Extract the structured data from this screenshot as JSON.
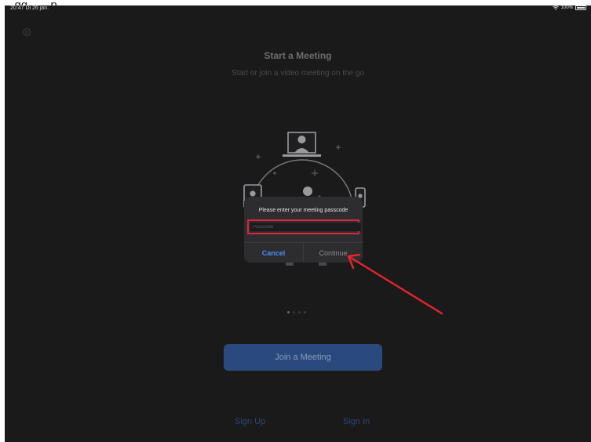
{
  "caption": "...gg...            ...p...",
  "status_bar": {
    "time": "20:47  Di 26 jan.",
    "battery": "100%"
  },
  "main": {
    "title": "Start a Meeting",
    "subtitle": "Start or join a video meeting on the go",
    "page_indicator": {
      "count": 4,
      "active": 0
    }
  },
  "dialog": {
    "title": "Please enter your meeting passcode",
    "passcode_placeholder": "Passcode",
    "passcode_value": "",
    "cancel_label": "Cancel",
    "continue_label": "Continue"
  },
  "join_button_label": "Join a Meeting",
  "footer": {
    "sign_up_label": "Sign Up",
    "sign_in_label": "Sign In"
  },
  "colors": {
    "background": "#1a1a1b",
    "accent_blue": "#4a8cf0",
    "highlight_red": "#d8263a",
    "join_button": "#2a4a7e"
  },
  "icons": {
    "settings": "gear-icon",
    "wifi": "wifi-icon",
    "battery": "battery-icon",
    "annotation": "red-arrow-icon"
  }
}
